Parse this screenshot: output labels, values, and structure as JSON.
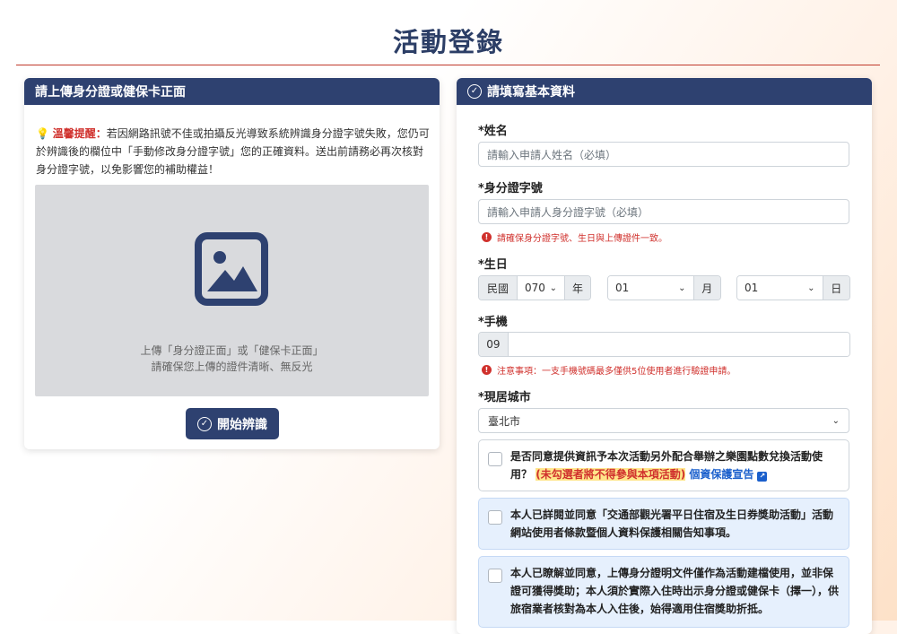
{
  "page": {
    "title": "活動登錄"
  },
  "upload_card": {
    "header": "請上傳身分證或健保卡正面",
    "hint_label": "溫馨提醒：",
    "hint_text": "若因網路訊號不佳或拍攝反光導致系統辨識身分證字號失敗，您仍可於辨識後的欄位中「手動修改身分證字號」您的正確資料。送出前請務必再次核對身分證字號，以免影響您的補助權益！",
    "upload_line1": "上傳「身分證正面」或「健保卡正面」",
    "upload_line2": "請確保您上傳的證件清晰、無反光",
    "start_button": "開始辨識"
  },
  "form_card": {
    "header": "請填寫基本資料",
    "name_label": "*姓名",
    "name_placeholder": "請輸入申請人姓名（必填）",
    "id_label": "*身分證字號",
    "id_placeholder": "請輸入申請人身分證字號（必填）",
    "id_error": "請確保身分證字號、生日與上傳證件一致。",
    "birthday_label": "*生日",
    "era_label": "民國",
    "year_value": "070",
    "year_unit": "年",
    "month_value": "01",
    "month_unit": "月",
    "day_value": "01",
    "day_unit": "日",
    "phone_label": "*手機",
    "phone_prefix": "09",
    "phone_note": "注意事項：一支手機號碼最多僅供5位使用者進行驗證申請。",
    "city_label": "*現居城市",
    "city_value": "臺北市",
    "consent1_text": "是否同意提供資訊予本次活動另外配合舉辦之樂園點數兌換活動使用？",
    "consent1_warning": "(未勾選者將不得參與本項活動)",
    "consent1_link": "個資保護宣告",
    "consent2_text": "本人已詳閱並同意「交通部觀光署平日住宿及生日券獎助活動」活動網站使用者條款暨個人資料保護相關告知事項。",
    "consent3_text": "本人已瞭解並同意，上傳身分證明文件僅作為活動建檔使用，並非保證可獲得獎助；本人須於實際入住時出示身分證或健保卡（擇一），供旅宿業者核對為本人入住後，始得適用住宿獎助折抵。"
  }
}
